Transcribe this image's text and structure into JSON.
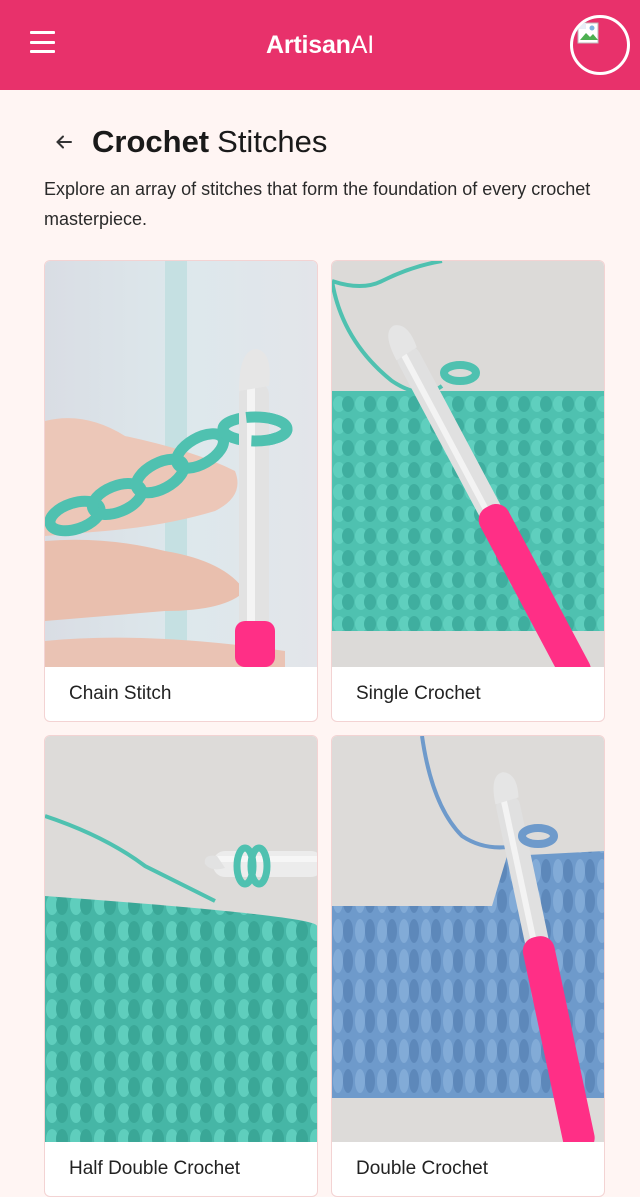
{
  "app": {
    "brand_bold": "Artisan",
    "brand_light": "AI",
    "menu_icon": "menu-icon",
    "avatar_icon": "broken-image-icon"
  },
  "page": {
    "title_bold": "Crochet",
    "title_light": "Stitches",
    "back_icon": "arrow-left-icon",
    "description": "Explore an array of stitches that form the foundation of every crochet masterpiece."
  },
  "stitches": [
    {
      "label": "Chain Stitch",
      "yarn_color": "#4fc1b0"
    },
    {
      "label": "Single Crochet",
      "yarn_color": "#4fc1b0"
    },
    {
      "label": "Half Double Crochet",
      "yarn_color": "#4fc1b0"
    },
    {
      "label": "Double Crochet",
      "yarn_color": "#6e9acb"
    }
  ],
  "colors": {
    "accent": "#e8316b",
    "background": "#fff5f3",
    "hook_pink": "#ff2f86"
  }
}
